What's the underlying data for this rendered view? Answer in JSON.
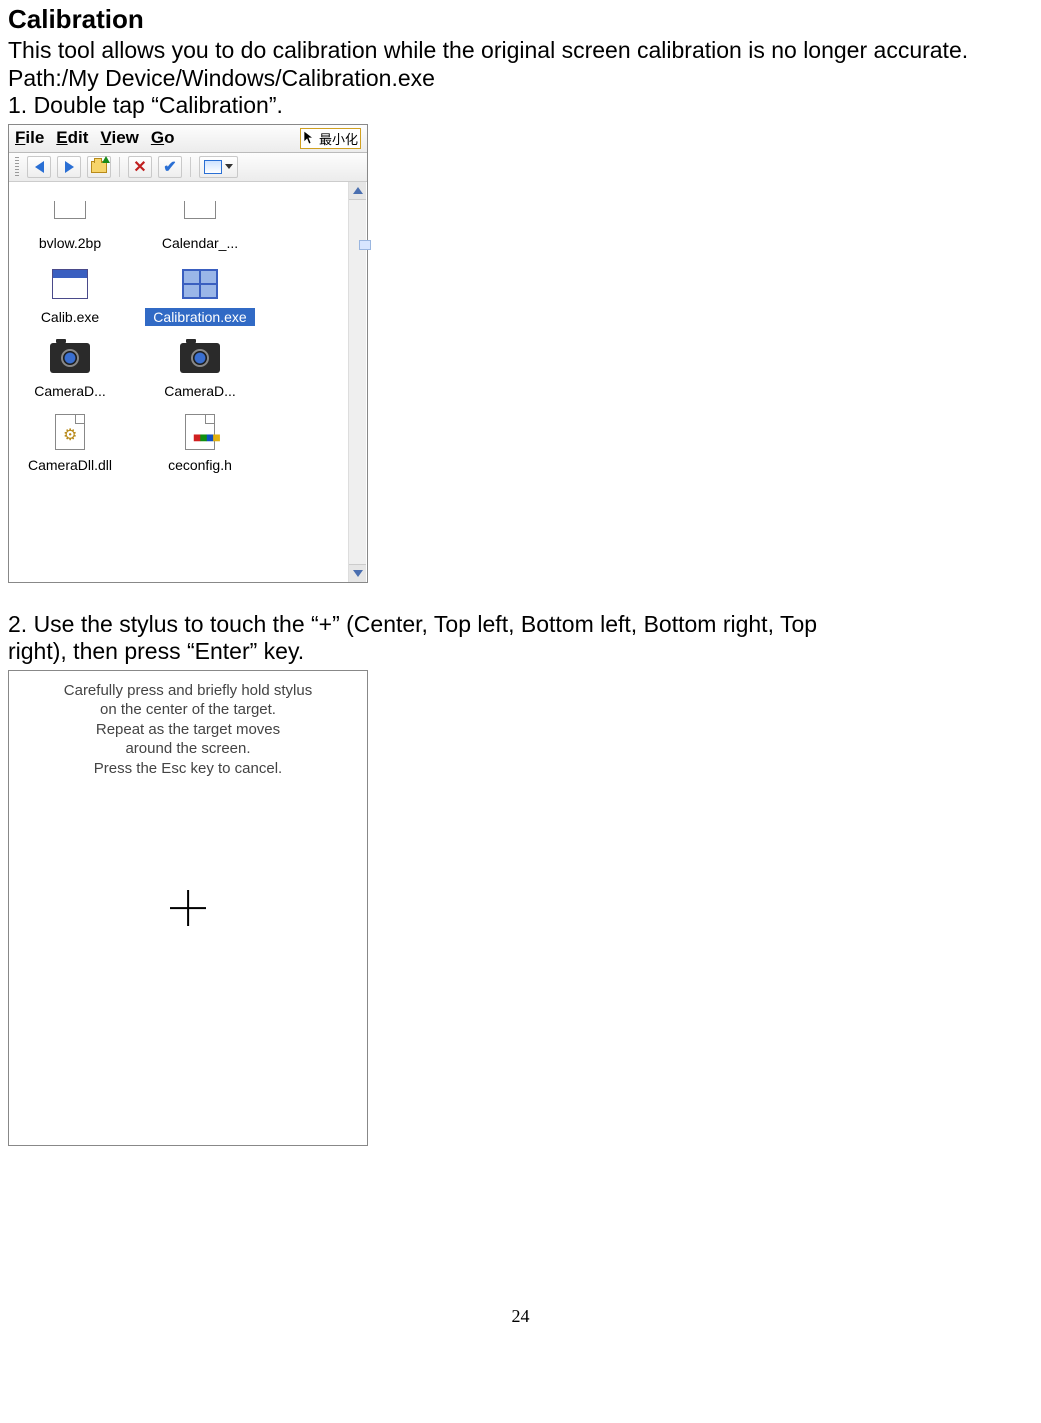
{
  "doc": {
    "heading": "Calibration",
    "intro": "This tool allows you to do calibration while the original screen calibration is no longer accurate.",
    "path": "Path:/My Device/Windows/Calibration.exe",
    "step1": "1. Double tap “Calibration”.",
    "step2a": "2. Use the stylus to touch the “+” (Center, Top left, Bottom left, Bottom right, Top",
    "step2b": "right), then press “Enter” key.",
    "page_number": "24"
  },
  "explorer": {
    "menus": {
      "file": "File",
      "edit": "Edit",
      "view": "View",
      "go": "Go"
    },
    "annotation_tag": "最小化",
    "files": {
      "f0": "bvlow.2bp",
      "f1": "Calendar_...",
      "f2": "Calib.exe",
      "f3": "Calibration.exe",
      "f4": "CameraD...",
      "f5": "CameraD...",
      "f6": "CameraDll.dll",
      "f7": "ceconfig.h"
    }
  },
  "calib_screen": {
    "line1": "Carefully press and briefly hold stylus",
    "line2": "on the center of the target.",
    "line3": "Repeat as the target moves",
    "line4": "around the screen.",
    "line5": "Press the Esc key to cancel."
  }
}
